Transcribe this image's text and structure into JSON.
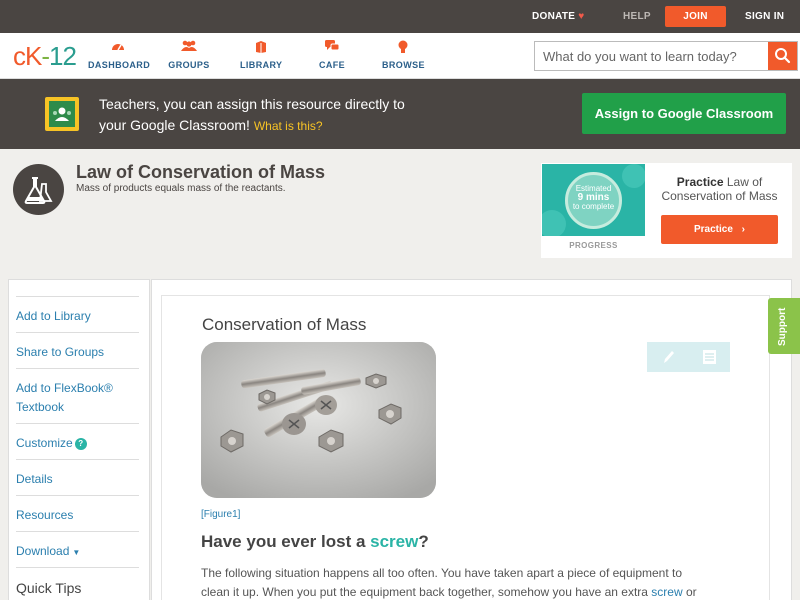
{
  "topbar": {
    "donate": "DONATE",
    "help": "HELP",
    "join": "JOIN",
    "signin": "SIGN IN"
  },
  "nav": {
    "logo": {
      "part1": "cK",
      "part2": "-",
      "part3": "12"
    },
    "items": [
      {
        "label": "DASHBOARD",
        "icon": "dashboard-icon"
      },
      {
        "label": "GROUPS",
        "icon": "groups-icon"
      },
      {
        "label": "LIBRARY",
        "icon": "library-icon"
      },
      {
        "label": "CAFE",
        "icon": "cafe-icon"
      },
      {
        "label": "BROWSE",
        "icon": "browse-icon"
      }
    ],
    "search_placeholder": "What do you want to learn today?"
  },
  "banner": {
    "line1": "Teachers, you can assign this resource directly to",
    "line2": "your Google Classroom!",
    "what_is_this": "What is this?",
    "assign_button": "Assign to Google Classroom"
  },
  "concept": {
    "title": "Law of Conservation of Mass",
    "subtitle": "Mass of products equals mass of the reactants."
  },
  "practice": {
    "estimated": "Estimated",
    "minutes": "9 mins",
    "to_complete": "to complete",
    "progress_label": "PROGRESS",
    "practice_bold": "Practice",
    "practice_rest": "Law of Conservation of Mass",
    "button": "Practice"
  },
  "sidebar": {
    "items": [
      {
        "label": "Add to Library"
      },
      {
        "label": "Share to Groups"
      },
      {
        "label": "Add to FlexBook®"
      },
      {
        "label": "Textbook"
      },
      {
        "label": "Customize"
      },
      {
        "label": "Details"
      },
      {
        "label": "Resources"
      },
      {
        "label": "Download"
      }
    ],
    "quick_tips": "Quick Tips"
  },
  "article": {
    "title": "Conservation of Mass",
    "figure_caption": "[Figure1]",
    "question_pre": "Have you ever lost a ",
    "question_hl": "screw",
    "question_post": "?",
    "para_line1": "The following situation happens all too often.  You have taken apart a piece of equipment to",
    "para_line2_pre": "clean it up. When you put the equipment back together, somehow you have an extra ",
    "para_line2_hl": "screw",
    "para_line2_post": " or"
  },
  "support": "Support",
  "colors": {
    "accent_orange": "#f15a2b",
    "dark_bar": "#4a4542",
    "classroom_green": "#21a049",
    "teal": "#2ab4a6",
    "link_blue": "#2b7fae",
    "support_green": "#8bc34a"
  }
}
